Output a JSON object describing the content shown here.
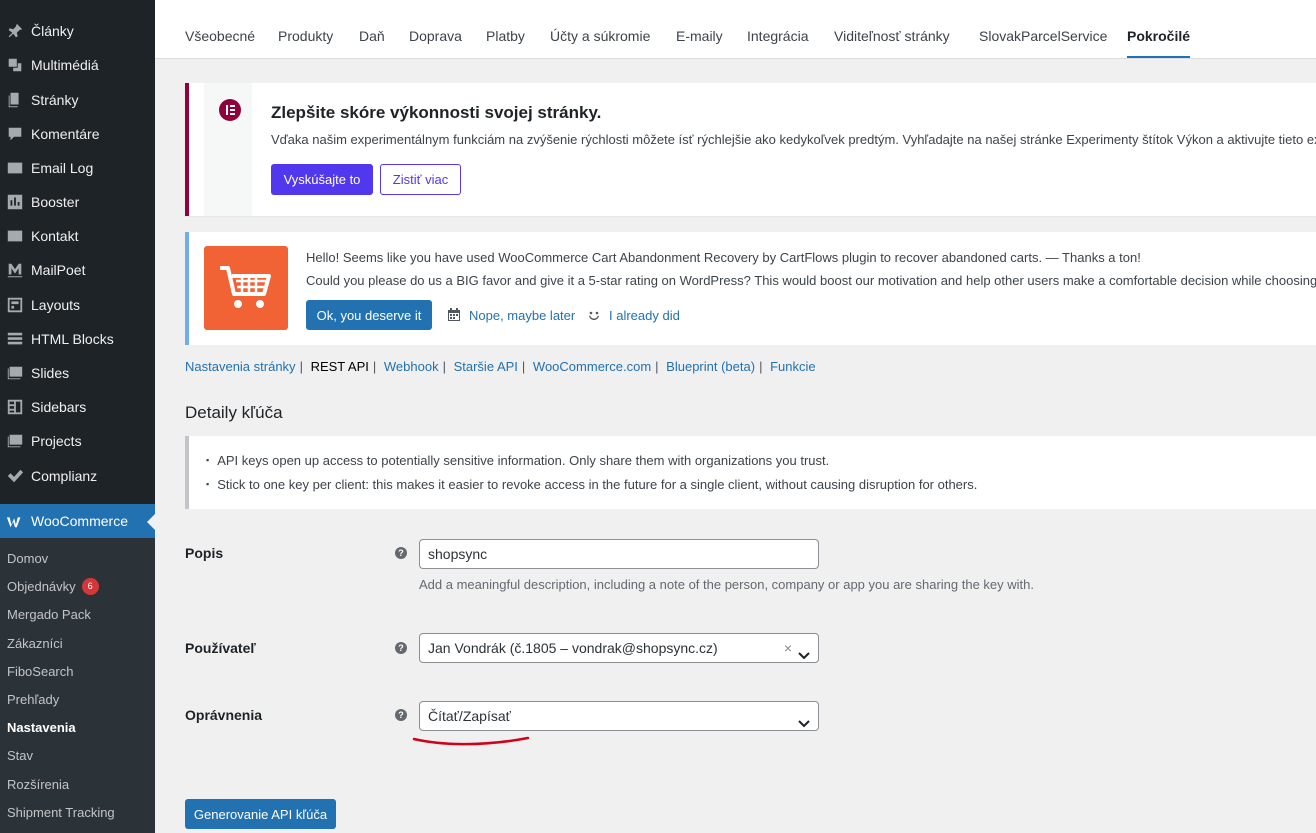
{
  "sidebar": {
    "items": [
      {
        "label": "Články",
        "icon": "pin-icon"
      },
      {
        "label": "Multimédiá",
        "icon": "media-icon"
      },
      {
        "label": "Stránky",
        "icon": "pages-icon"
      },
      {
        "label": "Komentáre",
        "icon": "comments-icon"
      },
      {
        "label": "Email Log",
        "icon": "email-icon"
      },
      {
        "label": "Booster",
        "icon": "chart-icon"
      },
      {
        "label": "Kontakt",
        "icon": "envelope-icon"
      },
      {
        "label": "MailPoet",
        "icon": "mailpoet-icon"
      },
      {
        "label": "Layouts",
        "icon": "layouts-icon"
      },
      {
        "label": "HTML Blocks",
        "icon": "blocks-icon"
      },
      {
        "label": "Slides",
        "icon": "slides-icon"
      },
      {
        "label": "Sidebars",
        "icon": "sidebars-icon"
      },
      {
        "label": "Projects",
        "icon": "projects-icon"
      },
      {
        "label": "Complianz",
        "icon": "check-icon"
      }
    ],
    "active": {
      "label": "WooCommerce",
      "icon": "woocommerce-icon"
    },
    "submenu": [
      {
        "label": "Domov"
      },
      {
        "label": "Objednávky",
        "badge": "6"
      },
      {
        "label": "Mergado Pack"
      },
      {
        "label": "Zákazníci"
      },
      {
        "label": "FiboSearch"
      },
      {
        "label": "Prehľady"
      },
      {
        "label": "Nastavenia",
        "current": true
      },
      {
        "label": "Stav"
      },
      {
        "label": "Rozšírenia"
      },
      {
        "label": "Shipment Tracking"
      }
    ]
  },
  "tabs": [
    {
      "label": "Všeobecné"
    },
    {
      "label": "Produkty"
    },
    {
      "label": "Daň"
    },
    {
      "label": "Doprava"
    },
    {
      "label": "Platby"
    },
    {
      "label": "Účty a súkromie"
    },
    {
      "label": "E-maily"
    },
    {
      "label": "Integrácia"
    },
    {
      "label": "Viditeľnosť stránky"
    },
    {
      "label": "SlovakParcelService"
    },
    {
      "label": "Pokročilé",
      "active": true
    }
  ],
  "elementor_notice": {
    "title": "Zlepšite skóre výkonnosti svojej stránky.",
    "description": "Vďaka našim experimentálnym funkciám na zvýšenie rýchlosti môžete ísť rýchlejšie ako kedykoľvek predtým. Vyhľadajte na našej stránke Experimenty štítok Výkon a aktivujte tieto ex",
    "try_label": "Vyskúšajte to",
    "more_label": "Zistiť viac",
    "accent": "#92003b",
    "button_color": "#5138ee"
  },
  "cartflows_notice": {
    "line1": "Hello! Seems like you have used WooCommerce Cart Abandonment Recovery by CartFlows plugin to recover abandoned carts. — Thanks a ton!",
    "line2": "Could you please do us a BIG favor and give it a 5-star rating on WordPress? This would boost our motivation and help other users make a comfortable decision while choosing",
    "ok_label": "Ok, you deserve it",
    "later_label": "Nope, maybe later",
    "did_label": "I already did",
    "logo_color": "#f16334"
  },
  "subnav": [
    {
      "label": "Nastavenia stránky"
    },
    {
      "label": "REST API",
      "current": true
    },
    {
      "label": "Webhook"
    },
    {
      "label": "Staršie API"
    },
    {
      "label": "WooCommerce.com"
    },
    {
      "label": "Blueprint (beta)"
    },
    {
      "label": "Funkcie"
    }
  ],
  "section_title": "Detaily kľúča",
  "info": [
    "API keys open up access to potentially sensitive information. Only share them with organizations you trust.",
    "Stick to one key per client: this makes it easier to revoke access in the future for a single client, without causing disruption for others."
  ],
  "form": {
    "description": {
      "label": "Popis",
      "value": "shopsync",
      "help": "Add a meaningful description, including a note of the person, company or app you are sharing the key with."
    },
    "user": {
      "label": "Používateľ",
      "value": "Jan Vondrák (č.1805 – vondrak@shopsync.cz)",
      "clear": "×"
    },
    "permissions": {
      "label": "Oprávnenia",
      "value": "Čítať/Zapísať"
    },
    "help_symbol": "?",
    "generate_label": "Generovanie API kľúča"
  },
  "colors": {
    "primary": "#2271b1",
    "sidebar": "#1d2327",
    "annotation": "#d0021b"
  }
}
